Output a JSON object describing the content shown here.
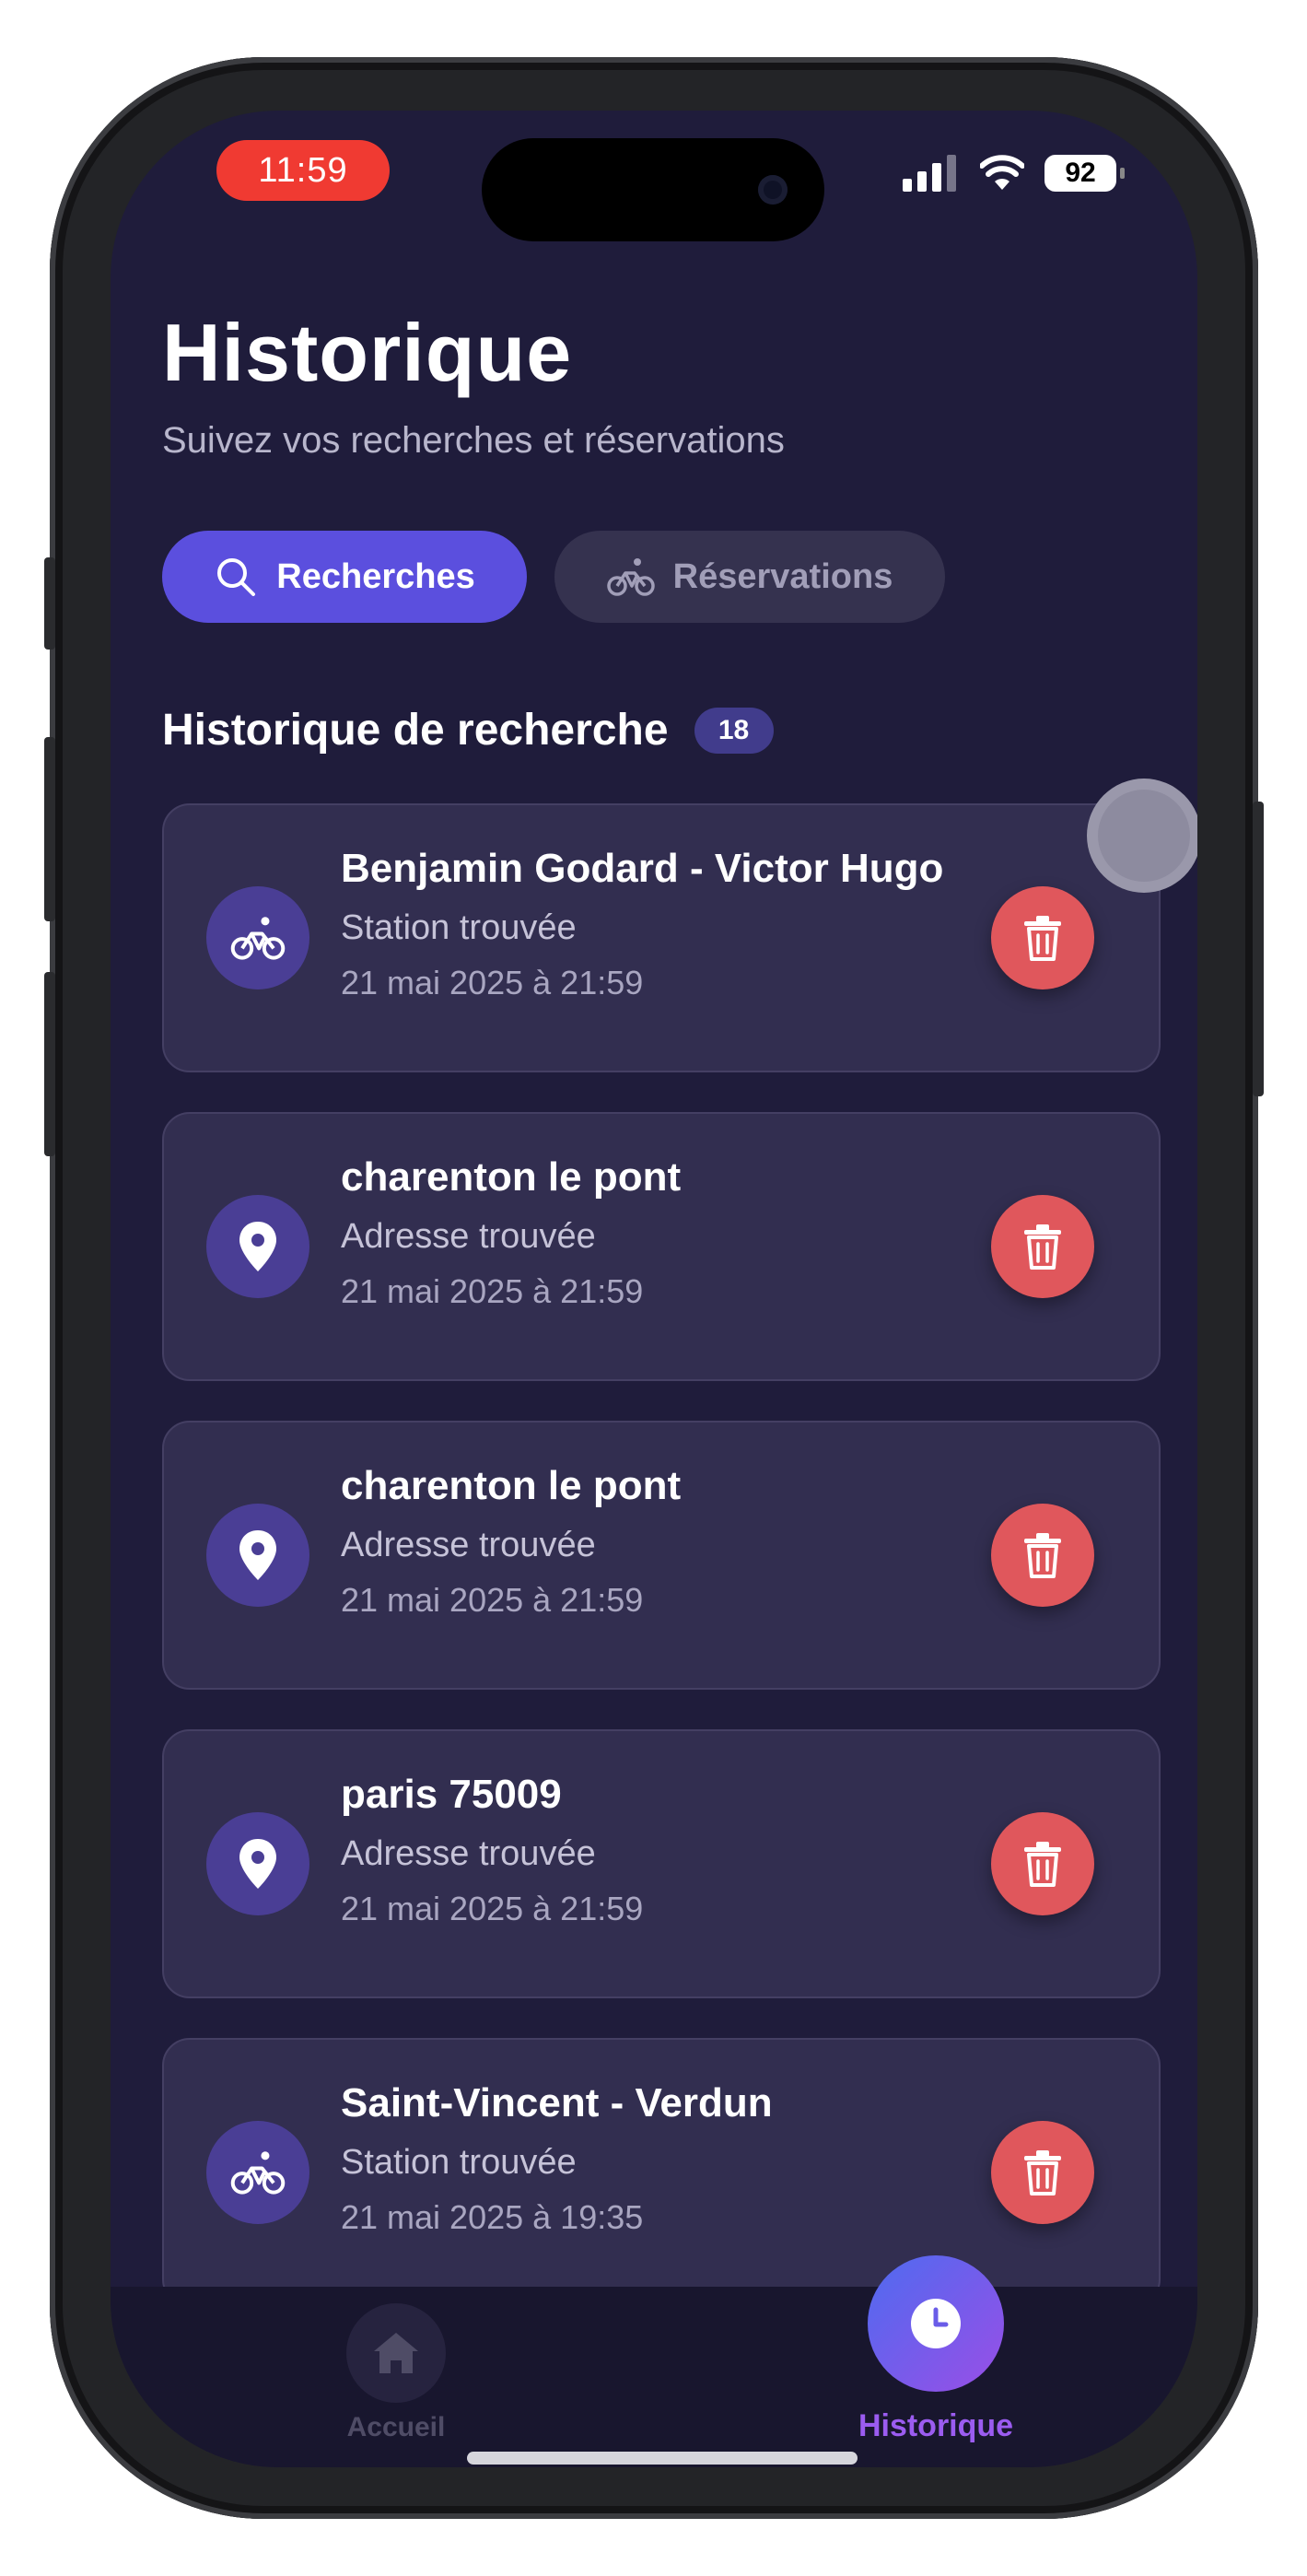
{
  "status_bar": {
    "time": "11:59",
    "battery": "92"
  },
  "header": {
    "title": "Historique",
    "subtitle": "Suivez vos recherches et réservations"
  },
  "tabs": [
    {
      "label": "Recherches",
      "active": true,
      "icon": "search-icon"
    },
    {
      "label": "Réservations",
      "active": false,
      "icon": "bike-icon"
    }
  ],
  "section": {
    "title": "Historique de recherche",
    "count": "18"
  },
  "history": [
    {
      "title": "Benjamin Godard - Victor Hugo",
      "status": "Station trouvée",
      "date": "21 mai 2025 à 21:59",
      "icon": "bike-icon"
    },
    {
      "title": "charenton le pont",
      "status": "Adresse trouvée",
      "date": "21 mai 2025 à 21:59",
      "icon": "location-pin-icon"
    },
    {
      "title": "charenton le pont",
      "status": "Adresse trouvée",
      "date": "21 mai 2025 à 21:59",
      "icon": "location-pin-icon"
    },
    {
      "title": "paris 75009",
      "status": "Adresse trouvée",
      "date": "21 mai 2025 à 21:59",
      "icon": "location-pin-icon"
    },
    {
      "title": "Saint-Vincent - Verdun",
      "status": "Station trouvée",
      "date": "21 mai 2025 à 19:35",
      "icon": "bike-icon"
    }
  ],
  "nav": {
    "home_label": "Accueil",
    "history_label": "Historique"
  },
  "colors": {
    "background": "#1f1c3b",
    "accent": "#5b4fde",
    "delete": "#e0575c",
    "active_nav": "#9b5cf0"
  }
}
